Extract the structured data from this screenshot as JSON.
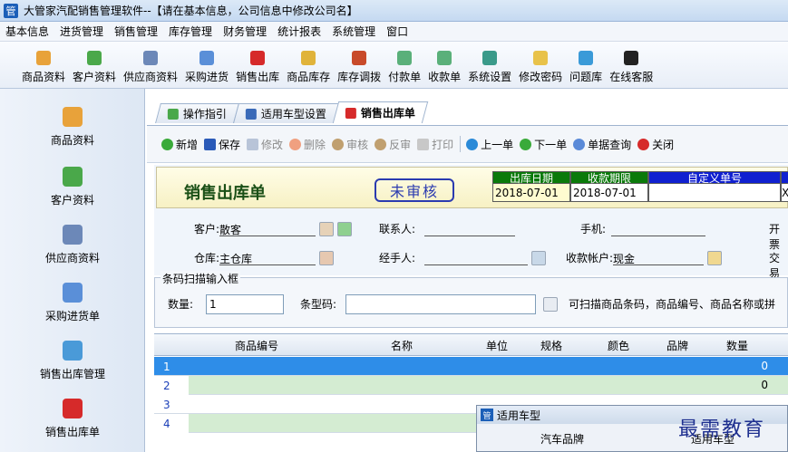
{
  "window": {
    "title": "大管家汽配销售管理软件--【请在基本信息，公司信息中修改公司名】",
    "icon_char": "管"
  },
  "menu": [
    "基本信息",
    "进货管理",
    "销售管理",
    "库存管理",
    "财务管理",
    "统计报表",
    "系统管理",
    "窗口"
  ],
  "toolbar": [
    "商品资料",
    "客户资料",
    "供应商资料",
    "采购进货",
    "销售出库",
    "商品库存",
    "库存调拨",
    "付款单",
    "收款单",
    "系统设置",
    "修改密码",
    "问题库",
    "在线客服"
  ],
  "sidebar": [
    "商品资料",
    "客户资料",
    "供应商资料",
    "采购进货单",
    "销售出库管理",
    "销售出库单"
  ],
  "tabs": [
    "操作指引",
    "适用车型设置",
    "销售出库单"
  ],
  "actions": [
    "新增",
    "保存",
    "修改",
    "删除",
    "审核",
    "反审",
    "打印",
    "上一单",
    "下一单",
    "单据查询",
    "关闭"
  ],
  "doc": {
    "title": "销售出库单",
    "status": "未审核",
    "col1_label": "出库日期",
    "col1_value": "2018-07-01",
    "col2_label": "收款期限",
    "col2_value": "2018-07-01",
    "col3_label": "自定义单号",
    "col3_value": "",
    "col4_value": "X"
  },
  "form": {
    "customer_label": "客户:",
    "customer_value": "散客",
    "contact_label": "联系人:",
    "phone_label": "手机:",
    "invoice_label": "开票",
    "warehouse_label": "仓库:",
    "warehouse_value": "主仓库",
    "handler_label": "经手人:",
    "account_label": "收款帐户:",
    "account_value": "现金",
    "trade_label": "交易"
  },
  "barcode": {
    "legend": "条码扫描输入框",
    "qty_label": "数量:",
    "qty_value": "1",
    "code_label": "条型码:",
    "hint": "可扫描商品条码，商品编号、商品名称或拼"
  },
  "grid": {
    "headers": [
      "商品编号",
      "名称",
      "单位",
      "规格",
      "颜色",
      "品牌",
      "数量"
    ],
    "rows": [
      {
        "n": "1",
        "qty": "0"
      },
      {
        "n": "2",
        "qty": "0"
      },
      {
        "n": "3",
        "qty": ""
      },
      {
        "n": "4",
        "qty": ""
      }
    ]
  },
  "popup": {
    "title": "适用车型",
    "col1": "汽车品牌",
    "col2": "适用车型"
  },
  "watermark": "最需教育",
  "colors": {
    "title_blue": "#1b5fb8",
    "selected_row": "#2e8de8",
    "row_green": "#d4ecd2",
    "doc_col_header": "#0a7a0a",
    "doc_col_header_blue": "#1020d0"
  }
}
